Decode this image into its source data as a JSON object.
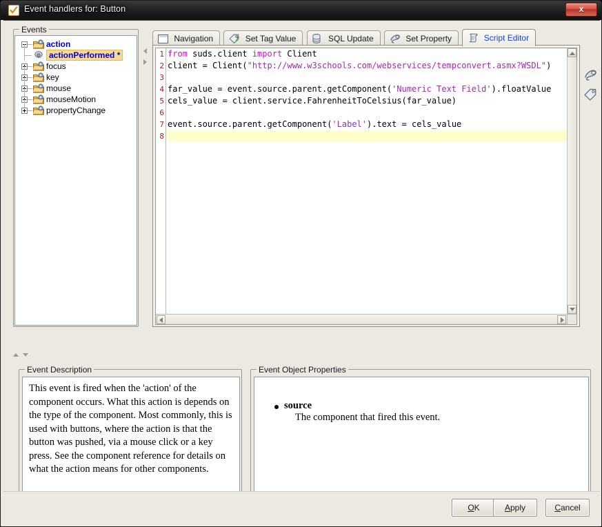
{
  "window": {
    "title": "Event handlers for: Button",
    "title_icon": "checkmark-icon",
    "close_label": "x"
  },
  "events_panel": {
    "group_title": "Events",
    "tree": [
      {
        "label": "action",
        "icon": "folder-icon",
        "expanded": true,
        "selected": false,
        "root": true
      },
      {
        "label": "actionPerformed *",
        "icon": "gear-icon",
        "expanded": false,
        "selected": true,
        "root": false
      },
      {
        "label": "focus",
        "icon": "folder-icon",
        "expanded": false,
        "selected": false,
        "root": false
      },
      {
        "label": "key",
        "icon": "folder-icon",
        "expanded": false,
        "selected": false,
        "root": false
      },
      {
        "label": "mouse",
        "icon": "folder-icon",
        "expanded": false,
        "selected": false,
        "root": false
      },
      {
        "label": "mouseMotion",
        "icon": "folder-icon",
        "expanded": false,
        "selected": false,
        "root": false
      },
      {
        "label": "propertyChange",
        "icon": "folder-icon",
        "expanded": false,
        "selected": false,
        "root": false
      }
    ]
  },
  "tabs": [
    {
      "label": "Navigation",
      "icon": "window-icon",
      "active": false
    },
    {
      "label": "Set Tag Value",
      "icon": "tag-icon",
      "active": false
    },
    {
      "label": "SQL Update",
      "icon": "database-icon",
      "active": false
    },
    {
      "label": "Set Property",
      "icon": "property-icon",
      "active": false
    },
    {
      "label": "Script Editor",
      "icon": "script-icon",
      "active": true
    }
  ],
  "rail_icons": [
    {
      "name": "property-icon"
    },
    {
      "name": "tag-icon"
    }
  ],
  "editor": {
    "current_line": 8,
    "lines": [
      {
        "n": 1,
        "text": "from suds.client import Client"
      },
      {
        "n": 2,
        "text": "client = Client(\"http://www.w3schools.com/webservices/tempconvert.asmx?WSDL\")"
      },
      {
        "n": 3,
        "text": ""
      },
      {
        "n": 4,
        "text": "far_value = event.source.parent.getComponent('Numeric Text Field').floatValue"
      },
      {
        "n": 5,
        "text": "cels_value = client.service.FahrenheitToCelsius(far_value)"
      },
      {
        "n": 6,
        "text": ""
      },
      {
        "n": 7,
        "text": "event.source.parent.getComponent('Label').text = cels_value"
      },
      {
        "n": 8,
        "text": ""
      }
    ],
    "colors": {
      "keyword": "#e600e6",
      "string": "#9b30a8",
      "linenumber": "#9c2222",
      "current_line_bg": "#ffffcc"
    }
  },
  "description_panel": {
    "group_title": "Event Description",
    "text": "This event is fired when the 'action' of the component occurs. What this action is depends on the type of the component. Most commonly, this is used with buttons, where the action is that the button was pushed, via a mouse click or a key press. See the component reference for details on what the action means for other components."
  },
  "properties_panel": {
    "group_title": "Event Object Properties",
    "items": [
      {
        "name": "source",
        "description": "The component that fired this event."
      }
    ]
  },
  "buttons": [
    {
      "id": "ok",
      "pre": "",
      "mn": "O",
      "post": "K"
    },
    {
      "id": "apply",
      "pre": "",
      "mn": "A",
      "post": "pply"
    },
    {
      "id": "cancel",
      "pre": "",
      "mn": "C",
      "post": "ancel"
    }
  ]
}
